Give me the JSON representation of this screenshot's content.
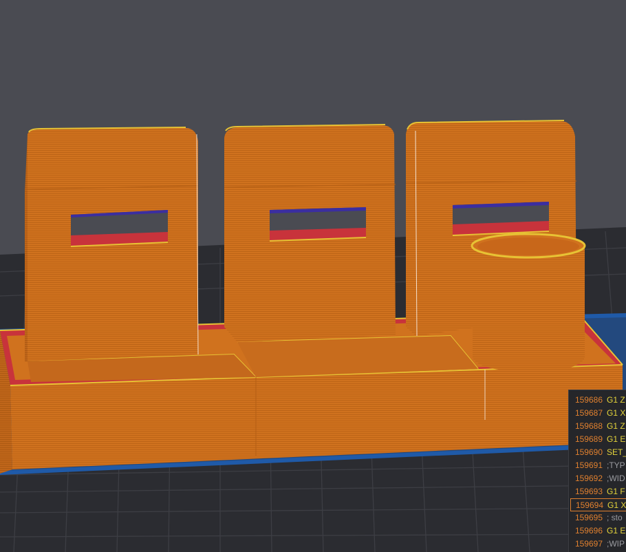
{
  "colors": {
    "background": "#4a4b52",
    "bed_grid": "#2b2c31",
    "part_orange": "#d0721e",
    "perimeter_yellow": "#e7c234",
    "infill_red": "#c8333b",
    "bridge_blue": "#3b2ea0",
    "skirt_blue": "#1f5aa8",
    "gcode_number": "#e0802f",
    "gcode_command": "#e4d43b",
    "gcode_comment": "#9a9ba0"
  },
  "gcode": {
    "lines": [
      {
        "num": "159686",
        "cmd": "G1 Z",
        "kind": "command"
      },
      {
        "num": "159687",
        "cmd": "G1 X",
        "kind": "command"
      },
      {
        "num": "159688",
        "cmd": "G1 Z",
        "kind": "command"
      },
      {
        "num": "159689",
        "cmd": "G1 E",
        "kind": "command"
      },
      {
        "num": "159690",
        "cmd": "SET_",
        "kind": "command"
      },
      {
        "num": "159691",
        "cmd": ";TYP",
        "kind": "comment"
      },
      {
        "num": "159692",
        "cmd": ";WID",
        "kind": "comment"
      },
      {
        "num": "159693",
        "cmd": "G1 F",
        "kind": "command"
      },
      {
        "num": "159694",
        "cmd": "G1 X",
        "kind": "command",
        "selected": true
      },
      {
        "num": "159695",
        "cmd": "; sto",
        "kind": "comment"
      },
      {
        "num": "159696",
        "cmd": "G1 E",
        "kind": "command"
      },
      {
        "num": "159697",
        "cmd": ";WIP",
        "kind": "comment"
      }
    ]
  }
}
